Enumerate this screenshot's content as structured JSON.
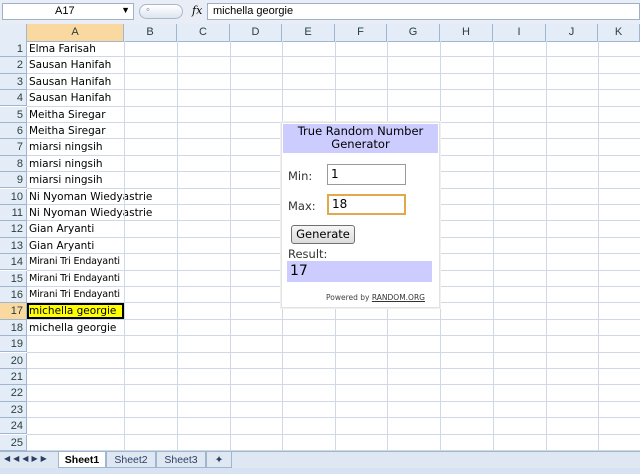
{
  "formula_bar": {
    "name_box": "A17",
    "fx_label": "fx",
    "formula": "michella georgie"
  },
  "columns": [
    "A",
    "B",
    "C",
    "D",
    "E",
    "F",
    "G",
    "H",
    "I",
    "J",
    "K"
  ],
  "rows": [
    {
      "num": "1",
      "a": "Elma Farisah"
    },
    {
      "num": "2",
      "a": "Sausan Hanifah"
    },
    {
      "num": "3",
      "a": "Sausan Hanifah"
    },
    {
      "num": "4",
      "a": "Sausan Hanifah"
    },
    {
      "num": "5",
      "a": "Meitha Siregar"
    },
    {
      "num": "6",
      "a": "Meitha Siregar"
    },
    {
      "num": "7",
      "a": "miarsi ningsih"
    },
    {
      "num": "8",
      "a": "miarsi ningsih"
    },
    {
      "num": "9",
      "a": "miarsi ningsih"
    },
    {
      "num": "10",
      "a": "Ni Nyoman Wiedyastrie"
    },
    {
      "num": "11",
      "a": "Ni Nyoman Wiedyastrie"
    },
    {
      "num": "12",
      "a": "Gian Aryanti"
    },
    {
      "num": "13",
      "a": "Gian Aryanti"
    },
    {
      "num": "14",
      "a": "Mirani Tri Endayanti"
    },
    {
      "num": "15",
      "a": "Mirani Tri Endayanti"
    },
    {
      "num": "16",
      "a": "Mirani Tri Endayanti"
    },
    {
      "num": "17",
      "a": "michella georgie"
    },
    {
      "num": "18",
      "a": "michella georgie"
    },
    {
      "num": "19",
      "a": ""
    },
    {
      "num": "20",
      "a": ""
    },
    {
      "num": "21",
      "a": ""
    },
    {
      "num": "22",
      "a": ""
    },
    {
      "num": "23",
      "a": ""
    },
    {
      "num": "24",
      "a": ""
    },
    {
      "num": "25",
      "a": ""
    }
  ],
  "widget": {
    "title": "True Random Number Generator",
    "min_label": "Min:",
    "min_value": "1",
    "max_label": "Max:",
    "max_value": "18",
    "generate_label": "Generate",
    "result_label": "Result:",
    "result_value": "17",
    "powered_prefix": "Powered by",
    "powered_link": "RANDOM.ORG"
  },
  "sheets": [
    "Sheet1",
    "Sheet2",
    "Sheet3"
  ],
  "active_sheet": "Sheet1",
  "colors": {
    "selection": "#ffff00",
    "header_highlight": "#f9d99f",
    "widget_accent": "#ccccff"
  }
}
